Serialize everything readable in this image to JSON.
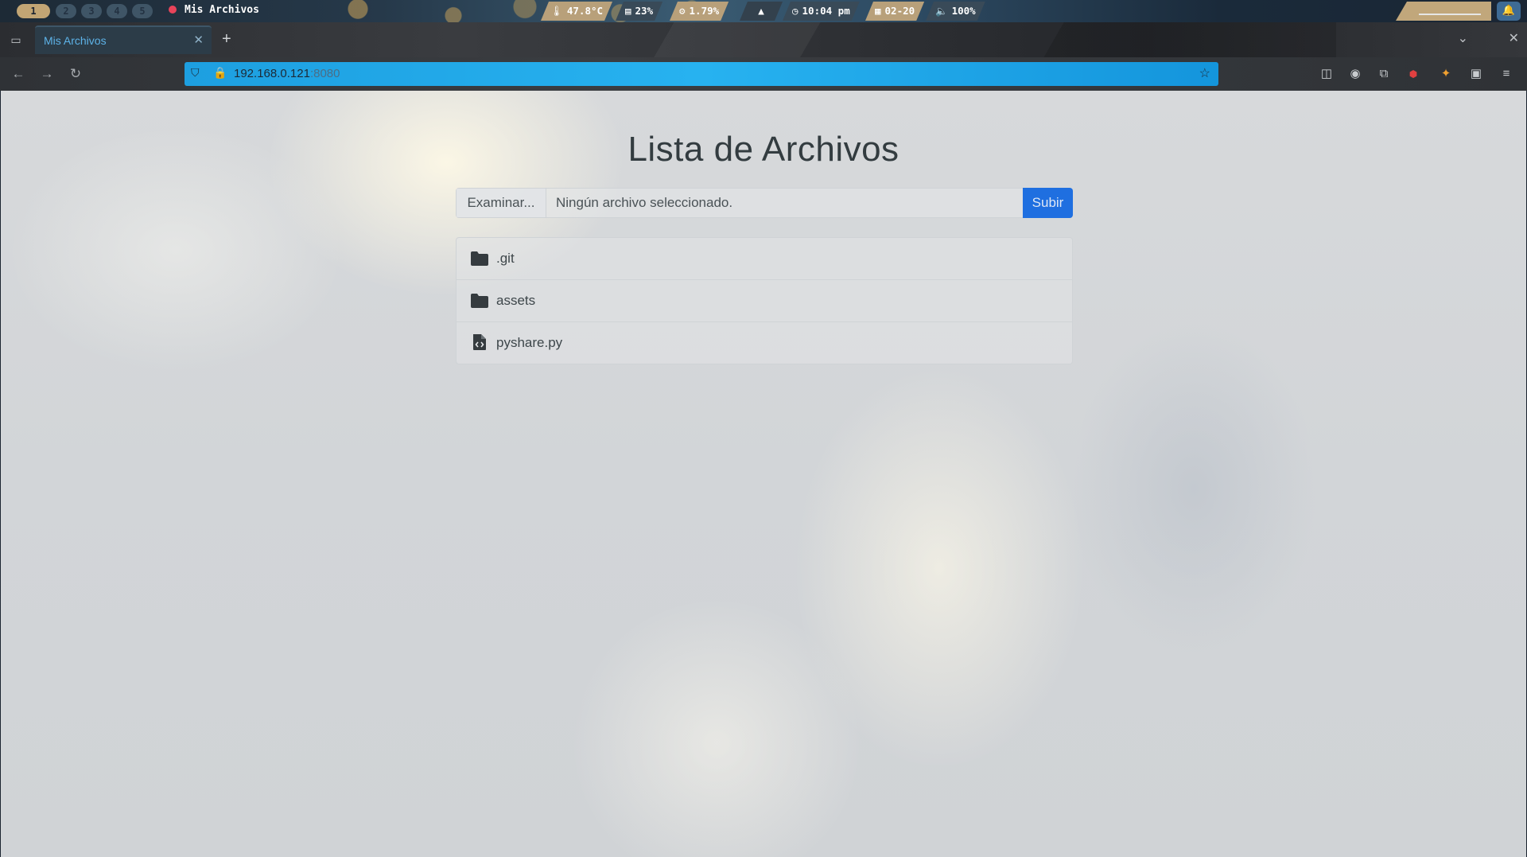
{
  "system_bar": {
    "workspaces": [
      "1",
      "2",
      "3",
      "4",
      "5"
    ],
    "active_workspace": "1",
    "window_title": "Mis Archivos",
    "temperature": "47.8°C",
    "memory": "23%",
    "cpu": "1.79%",
    "time": "10:04 pm",
    "date": "02-20",
    "volume": "100%"
  },
  "browser": {
    "tab_title": "Mis Archivos",
    "url_host": "192.168.0.121",
    "url_port": ":8080"
  },
  "page": {
    "title": "Lista de Archivos",
    "upload": {
      "browse_label": "Examinar...",
      "no_file_text": "Ningún archivo seleccionado.",
      "submit_label": "Subir"
    },
    "files": [
      {
        "name": ".git",
        "icon": "folder-icon"
      },
      {
        "name": "assets",
        "icon": "folder-icon"
      },
      {
        "name": "pyshare.py",
        "icon": "code-file-icon"
      }
    ]
  },
  "colors": {
    "accent": "#1f6fe0",
    "urlbar": "#27b2f0",
    "tab_text": "#5db3e8"
  }
}
